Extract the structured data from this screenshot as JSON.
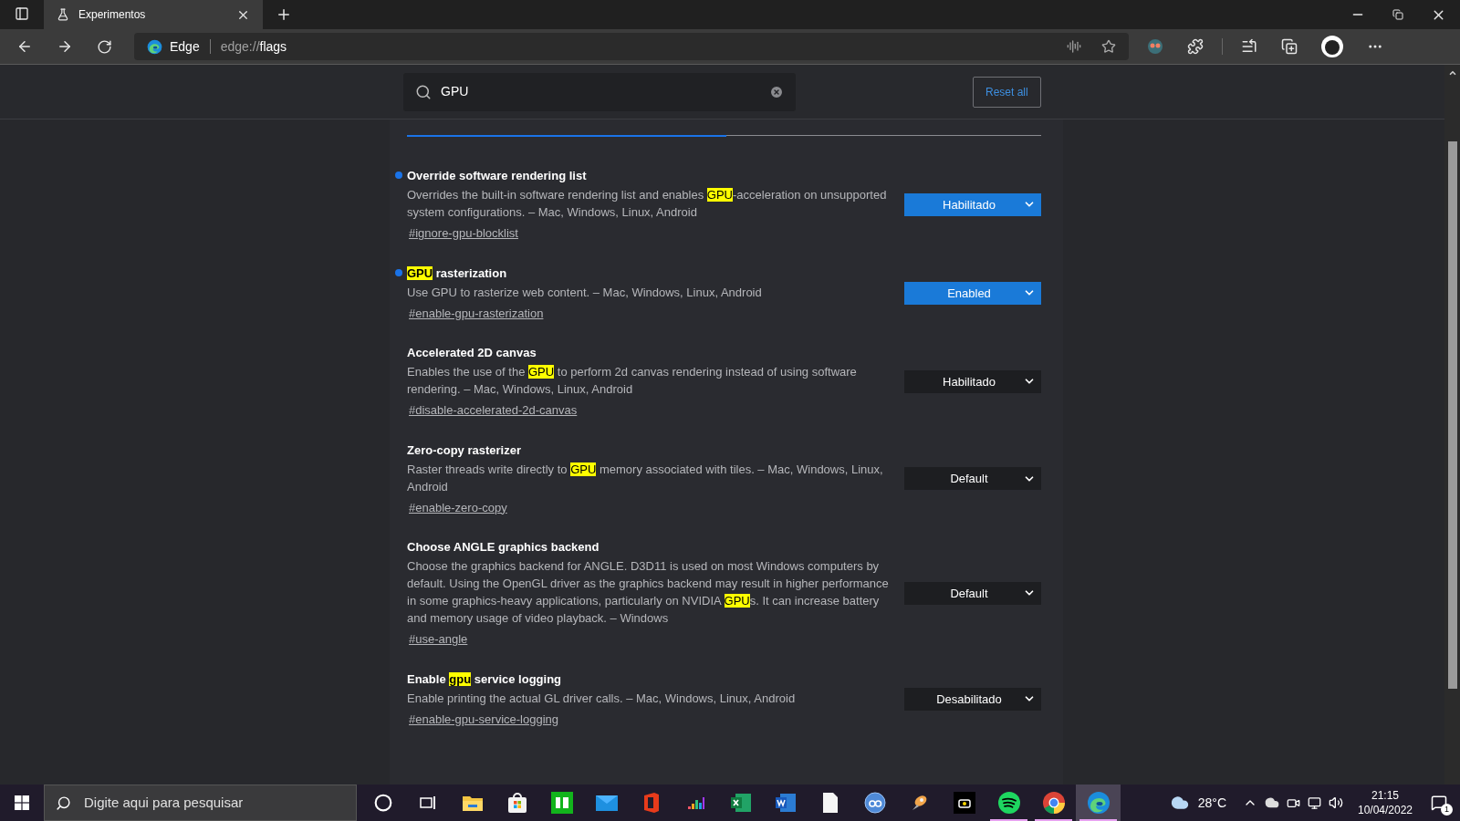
{
  "window": {
    "tab_title": "Experimentos"
  },
  "address_bar": {
    "site_label": "Edge",
    "url_scheme": "edge://",
    "url_path": "flags"
  },
  "search": {
    "value": "GPU"
  },
  "reset_button": "Reset all",
  "flags": [
    {
      "title": [
        {
          "text": "Override software rendering list",
          "highlighted": false
        }
      ],
      "description": [
        {
          "text": "Overrides the built-in software rendering list and enables ",
          "highlighted": false
        },
        {
          "text": "GPU",
          "highlighted": true
        },
        {
          "text": "-acceleration on unsupported system configurations. – Mac, Windows, Linux, Android",
          "highlighted": false
        }
      ],
      "link": "#ignore-gpu-blocklist",
      "modified": true,
      "value": "Habilitado"
    },
    {
      "title": [
        {
          "text": "GPU",
          "highlighted": true
        },
        {
          "text": " rasterization",
          "highlighted": false
        }
      ],
      "description": [
        {
          "text": "Use GPU to rasterize web content. – Mac, Windows, Linux, Android",
          "highlighted": false
        }
      ],
      "link": "#enable-gpu-rasterization",
      "modified": true,
      "value": "Enabled"
    },
    {
      "title": [
        {
          "text": "Accelerated 2D canvas",
          "highlighted": false
        }
      ],
      "description": [
        {
          "text": "Enables the use of the ",
          "highlighted": false
        },
        {
          "text": "GPU",
          "highlighted": true
        },
        {
          "text": " to perform 2d canvas rendering instead of using software rendering. – Mac, Windows, Linux, Android",
          "highlighted": false
        }
      ],
      "link": "#disable-accelerated-2d-canvas",
      "modified": false,
      "value": "Habilitado"
    },
    {
      "title": [
        {
          "text": "Zero-copy rasterizer",
          "highlighted": false
        }
      ],
      "description": [
        {
          "text": "Raster threads write directly to ",
          "highlighted": false
        },
        {
          "text": "GPU",
          "highlighted": true
        },
        {
          "text": " memory associated with tiles. – Mac, Windows, Linux, Android",
          "highlighted": false
        }
      ],
      "link": "#enable-zero-copy",
      "modified": false,
      "value": "Default"
    },
    {
      "title": [
        {
          "text": "Choose ANGLE graphics backend",
          "highlighted": false
        }
      ],
      "description": [
        {
          "text": "Choose the graphics backend for ANGLE. D3D11 is used on most Windows computers by default. Using the OpenGL driver as the graphics backend may result in higher performance in some graphics-heavy applications, particularly on NVIDIA ",
          "highlighted": false
        },
        {
          "text": "GPU",
          "highlighted": true
        },
        {
          "text": "s. It can increase battery and memory usage of video playback. – Windows",
          "highlighted": false
        }
      ],
      "link": "#use-angle",
      "modified": false,
      "value": "Default"
    },
    {
      "title": [
        {
          "text": "Enable ",
          "highlighted": false
        },
        {
          "text": "gpu",
          "highlighted": true
        },
        {
          "text": " service logging",
          "highlighted": false
        }
      ],
      "description": [
        {
          "text": "Enable printing the actual GL driver calls. – Mac, Windows, Linux, Android",
          "highlighted": false
        }
      ],
      "link": "#enable-gpu-service-logging",
      "modified": false,
      "value": "Desabilitado"
    }
  ],
  "taskbar": {
    "search_placeholder": "Digite aqui para pesquisar",
    "apps": [
      {
        "kind": "cortana",
        "running": false,
        "active": false
      },
      {
        "kind": "taskview",
        "running": false,
        "active": false
      },
      {
        "kind": "explorer",
        "running": false,
        "active": false
      },
      {
        "kind": "store",
        "running": false,
        "active": false
      },
      {
        "kind": "green-tile",
        "running": false,
        "active": false
      },
      {
        "kind": "mail",
        "running": false,
        "active": false
      },
      {
        "kind": "office",
        "running": false,
        "active": false
      },
      {
        "kind": "equalizer",
        "running": false,
        "active": false
      },
      {
        "kind": "excel",
        "running": false,
        "active": false
      },
      {
        "kind": "word",
        "running": false,
        "active": false
      },
      {
        "kind": "document",
        "running": false,
        "active": false
      },
      {
        "kind": "blue-circle",
        "running": false,
        "active": false
      },
      {
        "kind": "rocket",
        "running": false,
        "active": false
      },
      {
        "kind": "tv",
        "running": false,
        "active": false
      },
      {
        "kind": "spotify",
        "running": true,
        "active": false
      },
      {
        "kind": "chrome",
        "running": true,
        "active": false
      },
      {
        "kind": "edge",
        "running": true,
        "active": true
      }
    ],
    "temperature": "28°C",
    "time": "21:15",
    "date": "10/04/2022",
    "notification_count": "1"
  }
}
